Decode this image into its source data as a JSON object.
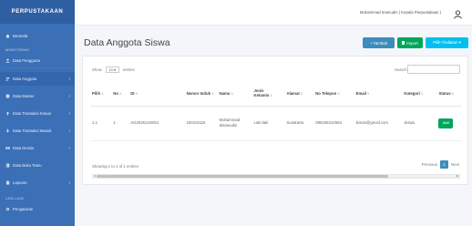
{
  "brand": "PERPUSTAKAAN",
  "sidebar": {
    "section1": "MONITORING",
    "items": [
      {
        "label": "Beranda"
      },
      {
        "label": "Data Pengguna"
      },
      {
        "label": "Data Anggota"
      },
      {
        "label": "Data Master"
      },
      {
        "label": "Data Transaksi Keluar"
      },
      {
        "label": "Data Transaksi Masuk"
      },
      {
        "label": "Data Denda"
      },
      {
        "label": "Data Buku Tamu"
      },
      {
        "label": "Laporan"
      }
    ],
    "section2": "LAIN-LAIN",
    "extra_items": [
      {
        "label": "Pengaturan"
      }
    ]
  },
  "topbar": {
    "user_name": "Muhammad Imanudin ( Kepala Perpustakaan )"
  },
  "page": {
    "title": "Data Anggota Siswa"
  },
  "buttons": {
    "tambah": "+ Tambah",
    "import": "Import",
    "pilih": "Pilih Tindakan ▾"
  },
  "table_controls": {
    "show_prefix": "Show",
    "show_value": "10",
    "show_suffix": "entries",
    "search_label": "Search:"
  },
  "table": {
    "headers": [
      "Pilih",
      "No",
      "ID",
      "Nomor Induk",
      "Nama",
      "Jenis Kelamin",
      "Alamat",
      "No Telepon",
      "Email",
      "Kategori",
      "Status"
    ],
    "rows": [
      {
        "pilih": "1.1",
        "no": "1",
        "id": "AG20251428G1",
        "nomor_induk": "150101116",
        "nama": "Muhammad Ikmanudin",
        "jenis_kelamin": "Laki-laki",
        "alamat": "Surakarta",
        "no_telepon": "085335312563",
        "email": "ikman@gmail.com",
        "kategori": "Siswa",
        "status": "Aktif"
      }
    ]
  },
  "footer": {
    "info": "Showing 1 to 1 of 1 entries",
    "previous": "Previous",
    "current_page": "1",
    "next": "Next"
  },
  "colors": {
    "sidebar": "#3b6fb6",
    "primary": "#3c8dbc",
    "success": "#00a65a",
    "info": "#00c0ef"
  }
}
